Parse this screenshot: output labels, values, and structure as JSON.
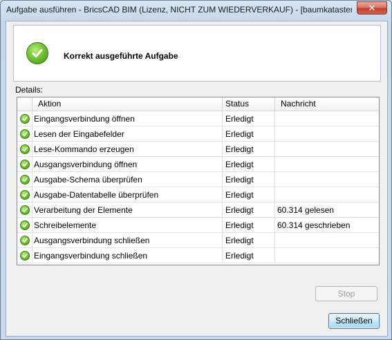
{
  "window": {
    "title": "Aufgabe ausführen - BricsCAD BIM (Lizenz, NICHT ZUM WIEDERVERKAUF) - [baumkataster_l...",
    "close_label": "✕"
  },
  "header": {
    "status_text": "Korrekt ausgeführte Aufgabe",
    "status_icon": "success-check-icon",
    "status_color": "#5cb82a"
  },
  "details": {
    "label": "Details:",
    "columns": [
      "",
      "Aktion",
      "Status",
      "Nachricht"
    ],
    "rows": [
      {
        "action": "Eingangsverbindung öffnen",
        "status": "Erledigt",
        "message": ""
      },
      {
        "action": "Lesen der Eingabefelder",
        "status": "Erledigt",
        "message": ""
      },
      {
        "action": "Lese-Kommando erzeugen",
        "status": "Erledigt",
        "message": ""
      },
      {
        "action": "Ausgangsverbindung öffnen",
        "status": "Erledigt",
        "message": ""
      },
      {
        "action": "Ausgabe-Schema überprüfen",
        "status": "Erledigt",
        "message": ""
      },
      {
        "action": "Ausgabe-Datentabelle überprüfen",
        "status": "Erledigt",
        "message": ""
      },
      {
        "action": "Verarbeitung der Elemente",
        "status": "Erledigt",
        "message": "60.314 gelesen"
      },
      {
        "action": "Schreibelemente",
        "status": "Erledigt",
        "message": "60.314 geschrieben"
      },
      {
        "action": "Ausgangsverbindung schließen",
        "status": "Erledigt",
        "message": ""
      },
      {
        "action": "Eingangsverbindung schließen",
        "status": "Erledigt",
        "message": ""
      }
    ]
  },
  "buttons": {
    "stop_label": "Stop",
    "close_label": "Schließen"
  }
}
